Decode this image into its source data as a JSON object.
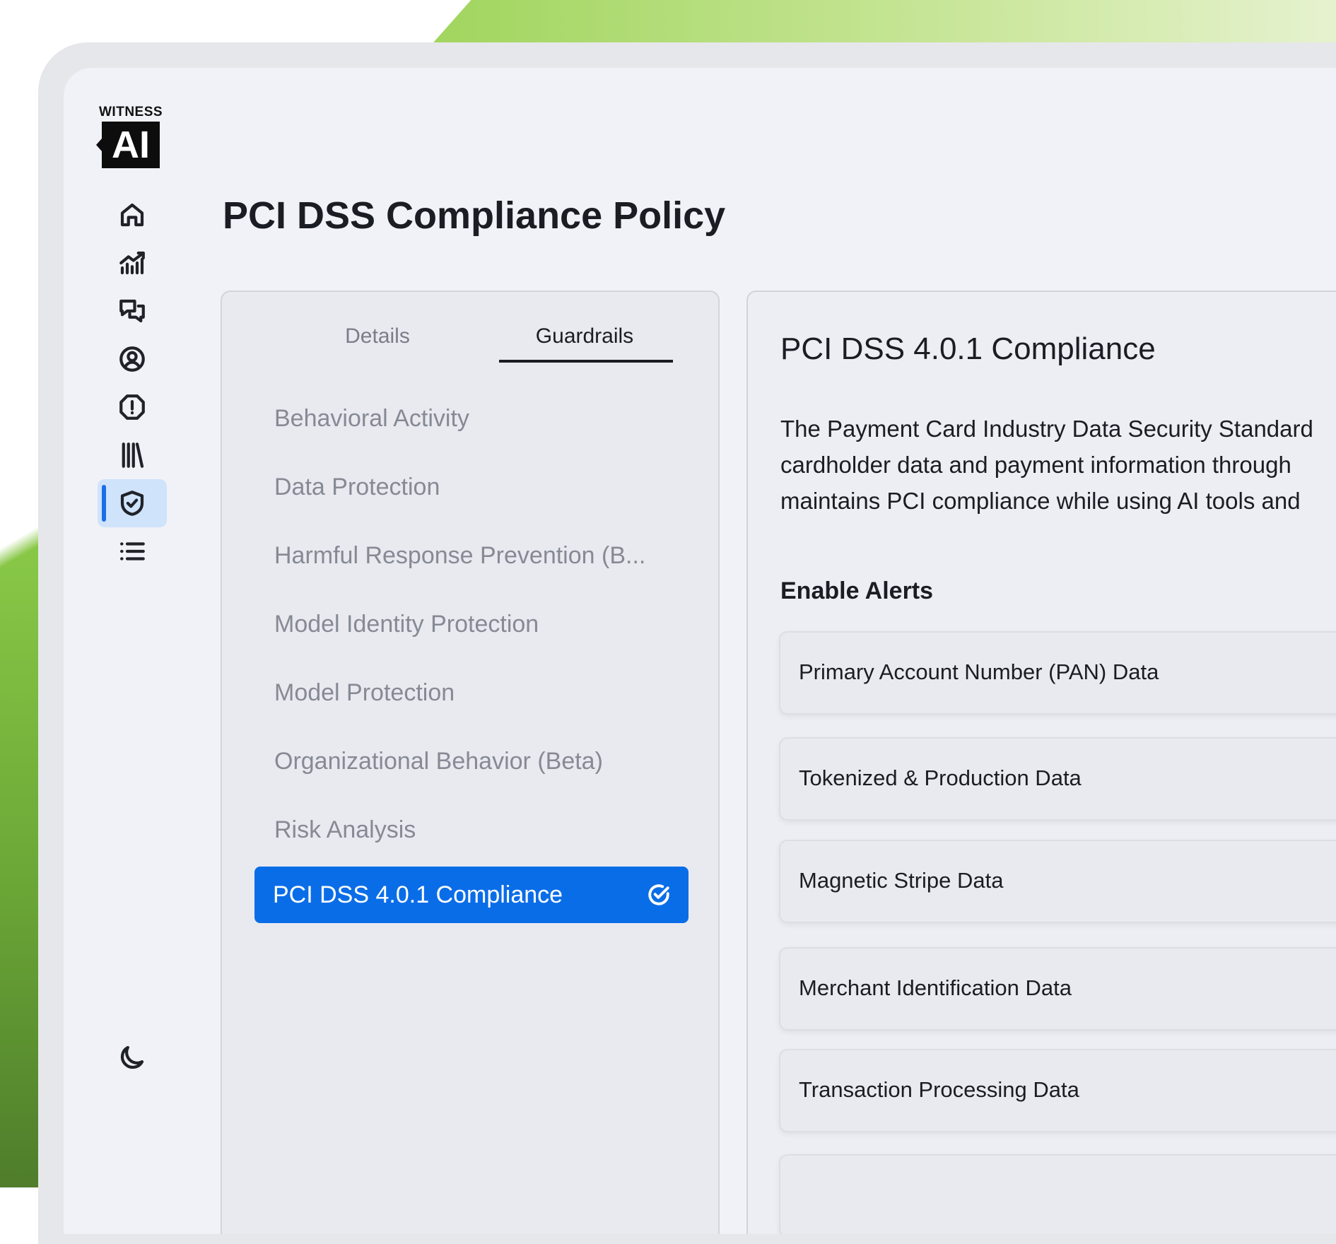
{
  "brand": {
    "top": "WITNESS",
    "mark": "AI"
  },
  "page": {
    "title": "PCI DSS Compliance Policy"
  },
  "sidebar": {
    "items": [
      {
        "icon": "home-icon",
        "active": false
      },
      {
        "icon": "analytics-chart-icon",
        "active": false
      },
      {
        "icon": "chat-bubbles-icon",
        "active": false
      },
      {
        "icon": "user-circle-icon",
        "active": false
      },
      {
        "icon": "alert-octagon-icon",
        "active": false
      },
      {
        "icon": "library-icon",
        "active": false
      },
      {
        "icon": "shield-check-icon",
        "active": true
      },
      {
        "icon": "list-icon",
        "active": false
      }
    ],
    "theme_icon": "moon-icon",
    "accent": "#1a6fe6"
  },
  "tabs": {
    "details": "Details",
    "guardrails": "Guardrails",
    "active": "guardrails"
  },
  "guardrails": {
    "items": [
      "Behavioral Activity",
      "Data Protection",
      "Harmful Response Prevention (B...",
      "Model Identity Protection",
      "Model Protection",
      "Organizational Behavior (Beta)",
      "Risk Analysis"
    ],
    "selected": "PCI DSS 4.0.1 Compliance",
    "selected_color": "#0a6de8"
  },
  "detail": {
    "title": "PCI DSS 4.0.1 Compliance",
    "description_lines": [
      "The Payment Card Industry Data Security Standard",
      "cardholder data and payment information through",
      "maintains PCI compliance while using AI tools and"
    ],
    "alerts_heading": "Enable Alerts",
    "alerts": [
      "Primary Account Number (PAN) Data",
      "Tokenized & Production Data",
      "Magnetic Stripe Data",
      "Merchant Identification Data",
      "Transaction Processing Data"
    ]
  }
}
